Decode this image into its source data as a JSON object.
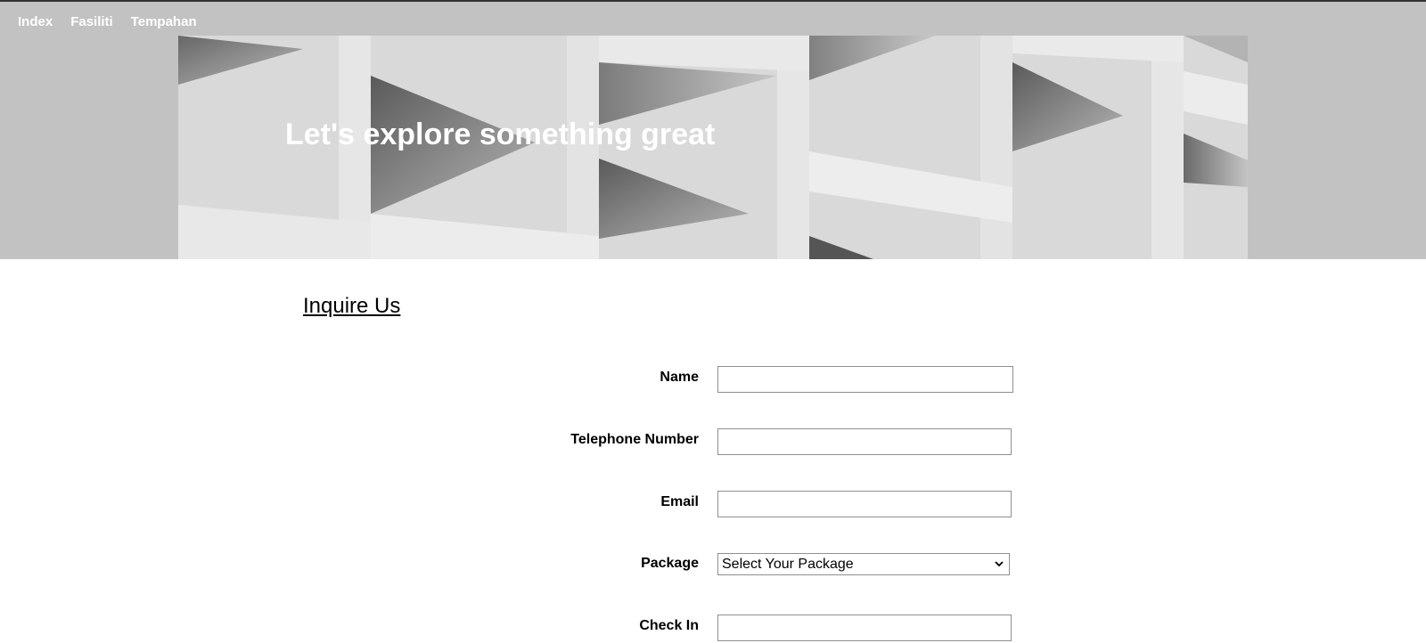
{
  "nav": {
    "items": [
      {
        "label": "Index"
      },
      {
        "label": "Fasiliti"
      },
      {
        "label": "Tempahan"
      }
    ]
  },
  "hero": {
    "title": "Let's explore something great"
  },
  "inquiry": {
    "title": "Inquire Us",
    "fields": {
      "name": {
        "label": "Name",
        "value": ""
      },
      "telephone": {
        "label": "Telephone Number",
        "value": ""
      },
      "email": {
        "label": "Email",
        "value": ""
      },
      "package": {
        "label": "Package",
        "selected": "Select Your Package"
      },
      "checkin": {
        "label": "Check In",
        "value": ""
      }
    }
  },
  "colors": {
    "header_bg": "#c2c2c2",
    "nav_text": "#ffffff",
    "input_border": "#8f8f8f"
  }
}
